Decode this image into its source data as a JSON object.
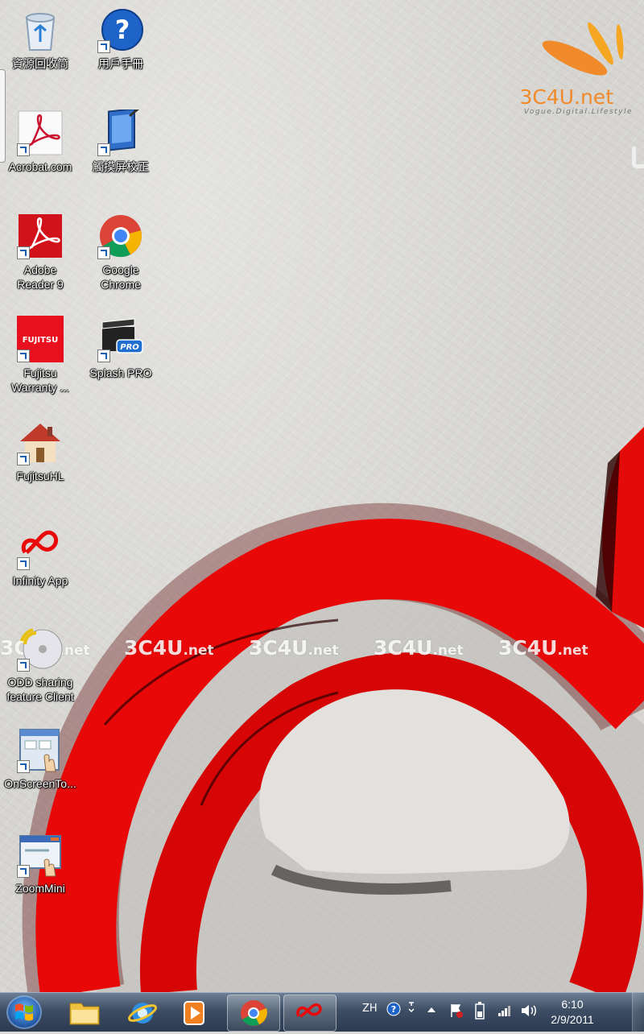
{
  "desktop": {
    "icons": [
      {
        "label": "資源回收筒",
        "icon": "recycle-bin-icon"
      },
      {
        "label": "用戶手冊",
        "icon": "help-icon"
      },
      {
        "label": "Acrobat.com",
        "icon": "acrobat-com-icon"
      },
      {
        "label": "觸摸屏校正",
        "icon": "touchscreen-calibration-icon"
      },
      {
        "label": "Adobe\nReader 9",
        "icon": "adobe-reader-icon"
      },
      {
        "label": "Google\nChrome",
        "icon": "chrome-icon"
      },
      {
        "label": "Fujitsu\nWarranty ...",
        "icon": "fujitsu-icon"
      },
      {
        "label": "Splash PRO",
        "icon": "splash-pro-icon"
      },
      {
        "label": "FujitsuHL",
        "icon": "home-icon"
      },
      {
        "label": "Infinity App",
        "icon": "infinity-icon"
      },
      {
        "label": "ODD sharing\nfeature Client",
        "icon": "disc-sharing-icon"
      },
      {
        "label": "OnScreenTo...",
        "icon": "onscreen-touch-icon"
      },
      {
        "label": "ZoomMini",
        "icon": "zoom-mini-icon"
      }
    ],
    "watermark": "3C4U",
    "watermark_suffix": ".net",
    "logo_text": "3C4U.net",
    "logo_tagline": "Vogue.Digital.Lifestyle"
  },
  "taskbar": {
    "items": [
      {
        "name": "Windows Explorer",
        "icon": "folder-icon",
        "state": "pinned"
      },
      {
        "name": "Internet Explorer",
        "icon": "ie-icon",
        "state": "pinned"
      },
      {
        "name": "Media Player",
        "icon": "media-icon",
        "state": "pinned"
      },
      {
        "name": "Google Chrome",
        "icon": "chrome-icon",
        "state": "running"
      },
      {
        "name": "Infinity App",
        "icon": "infinity-icon",
        "state": "running"
      }
    ],
    "tray": {
      "language": "ZH",
      "time": "6:10",
      "date": "2/9/2011"
    }
  },
  "colors": {
    "taskbar": "#3d4d63",
    "wallpaper": "#d6d5d1",
    "brand_red": "#e8090a",
    "logo_orange": "#f08a2a"
  }
}
